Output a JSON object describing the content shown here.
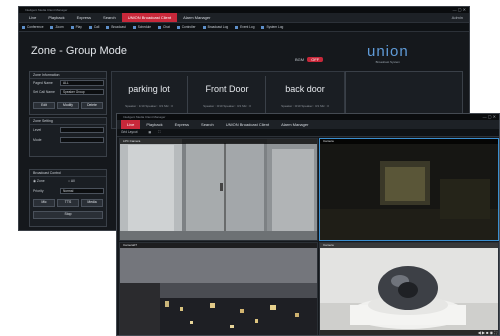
{
  "back_window": {
    "title": "Inteligent Media Client Manager",
    "menu": [
      "Live",
      "Playback",
      "Express",
      "Search",
      "UNION Broadcast Client",
      "Alarm Manager"
    ],
    "active_menu": "UNION Broadcast Client",
    "user": "Admin",
    "toolbar": [
      "Conference",
      "Zoom",
      "Play",
      "Call",
      "Broadcast",
      "Schedule",
      "Chat",
      "Controller",
      "Broadcast Log",
      "Event Log",
      "System Log"
    ],
    "page_title": "Zone - Group Mode",
    "brand": "union",
    "brand_sub": "Broadcast System",
    "bgm_label": "BGM",
    "bgm_value": "OFF",
    "zones": [
      {
        "name": "parking lot",
        "sub": "Speaker : 1/10 Speaker : 0/1 Mic : 0"
      },
      {
        "name": "Front Door",
        "sub": "Speaker : 0/10 Speaker : 0/1 Mic : 0"
      },
      {
        "name": "back door",
        "sub": "Speaker : 0/10 Speaker : 0/1 Mic : 0"
      }
    ],
    "left_panel": {
      "title": "Zone Information",
      "rows": [
        {
          "label": "Paged Name",
          "value": "ALL"
        },
        {
          "label": "Set Call Name",
          "value": "Speaker Group"
        }
      ],
      "buttons": [
        "Edit",
        "Modify",
        "Delete"
      ]
    },
    "audio_panel": {
      "title": "Zone Setting",
      "rows": [
        {
          "label": "Level",
          "value": ""
        },
        {
          "label": "Mode",
          "value": ""
        }
      ]
    },
    "broadcast_panel": {
      "title": "Broadcast Control",
      "radio_a": "Zone",
      "radio_b": "All",
      "priority_label": "Priority",
      "priority_value": "Normal",
      "buttons": [
        "Mic",
        "TTS",
        "Media"
      ],
      "stop": "Stop"
    }
  },
  "front_window": {
    "title": "Inteligent Media Client Manager",
    "menu": [
      "Live",
      "Playback",
      "Express",
      "Search",
      "UNION Broadcast Client",
      "Alarm Manager"
    ],
    "active_menu": "Live",
    "subbar_left": "Grid Layout",
    "cameras": [
      {
        "label": "LPC Camera"
      },
      {
        "label": "Camera"
      },
      {
        "label": "Camera07"
      },
      {
        "label": "Camera"
      }
    ]
  }
}
